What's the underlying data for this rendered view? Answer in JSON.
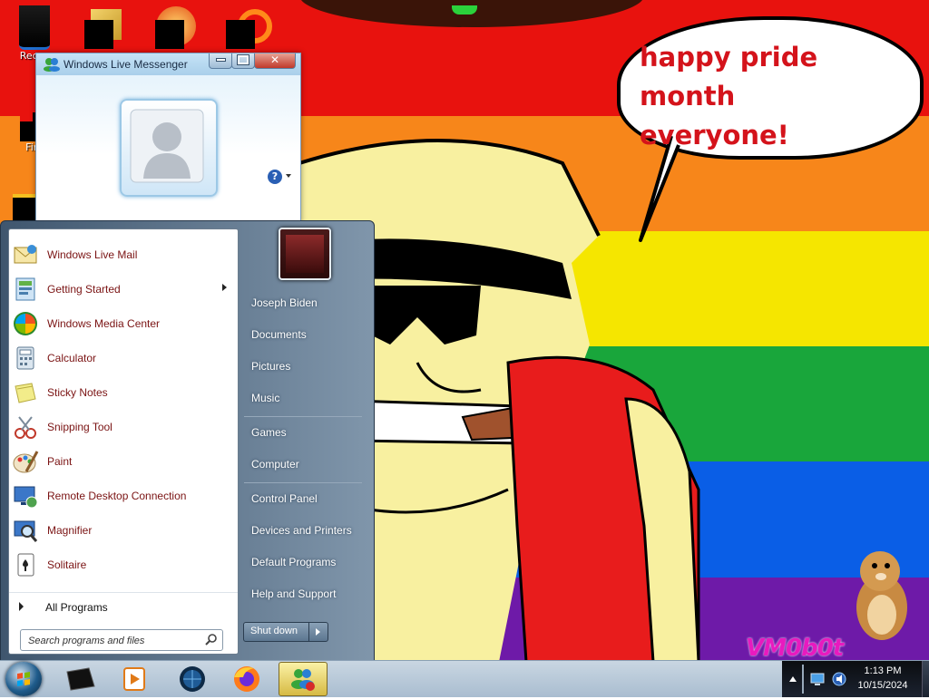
{
  "desktop": {
    "icons": [
      {
        "label": "Recyc",
        "icon": "recycle-bin-icon"
      },
      {
        "label": "Fire",
        "icon": "firefox-shortcut-icon"
      }
    ],
    "speech_bubble": {
      "line1": "happy pride month",
      "line2": "everyone!"
    },
    "watermark": "VM0b0t",
    "colors": {
      "red": "#e8120e",
      "orange": "#f7861a",
      "yellow": "#f5e600",
      "green": "#19a63b",
      "blue": "#0a5ee6",
      "purple": "#6e1aa8"
    }
  },
  "messenger": {
    "title": "Windows Live Messenger",
    "help_label": "?"
  },
  "start_menu": {
    "programs": [
      {
        "label": "Windows Live Mail",
        "icon": "mail-icon"
      },
      {
        "label": "Getting Started",
        "icon": "getting-started-icon",
        "submenu": true
      },
      {
        "label": "Windows Media Center",
        "icon": "media-center-icon"
      },
      {
        "label": "Calculator",
        "icon": "calculator-icon"
      },
      {
        "label": "Sticky Notes",
        "icon": "sticky-notes-icon"
      },
      {
        "label": "Snipping Tool",
        "icon": "snipping-tool-icon"
      },
      {
        "label": "Paint",
        "icon": "paint-icon"
      },
      {
        "label": "Remote Desktop Connection",
        "icon": "remote-desktop-icon"
      },
      {
        "label": "Magnifier",
        "icon": "magnifier-icon"
      },
      {
        "label": "Solitaire",
        "icon": "solitaire-icon"
      }
    ],
    "all_programs": "All Programs",
    "search_placeholder": "Search programs and files",
    "right_items": {
      "user": "Joseph Biden",
      "documents": "Documents",
      "pictures": "Pictures",
      "music": "Music",
      "games": "Games",
      "computer": "Computer",
      "control_panel": "Control Panel",
      "devices": "Devices and Printers",
      "defaults": "Default Programs",
      "help": "Help and Support"
    },
    "shutdown": "Shut down"
  },
  "taskbar": {
    "clock_time": "1:13 PM",
    "clock_date": "10/15/2024",
    "pinned": [
      "command-prompt-icon",
      "media-player-icon",
      "globe-icon",
      "firefox-icon",
      "messenger-icon"
    ]
  }
}
